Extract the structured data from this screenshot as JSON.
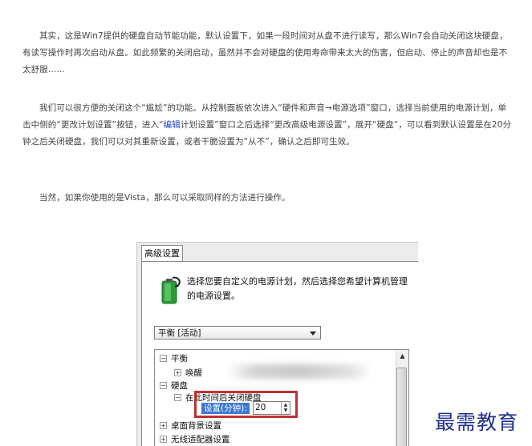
{
  "article": {
    "p1": "其实，这是Win7提供的硬盘自动节能功能，默认设置下，如果一段时间对从盘不进行读写，那么Win7会自动关闭这块硬盘，有读写操作时再次启动从盘。如此频繁的关闭启动，虽然并不会对硬盘的使用寿命带来太大的伤害，但启动、停止的声音却也是不太舒服……",
    "p2_a": "我们可以很方便的关闭这个“尴尬”的功能。从控制面板依次进入“硬件和声音→电源选项”窗口，选择当前使用的电源计划，单击中侧的“更改计划设置”按钮，进入“",
    "p2_link": "编辑",
    "p2_b": "计划设置”窗口之后选择“更改高级电源设置”，展开“硬盘”，可以看到默认设置是在20分钟之后关闭硬盘，我们可以对其重新设置，或者干脆设置为“从不”，确认之后即可生效。",
    "p3": "当然，如果你使用的是Vista，那么可以采取同样的方法进行操作。"
  },
  "dialog": {
    "tab_label": "高级设置",
    "description": "选择您要自定义的电源计划，然后选择您希望计算机管理的电源设置。",
    "plan_selected": "平衡 [活动]",
    "tree": {
      "balance": "平衡",
      "wake_password": "唤醒",
      "hard_disk": "硬盘",
      "turn_off_after": "在此时间后关闭硬盘",
      "setting_label": "设置(分钟):",
      "setting_value": "20",
      "desktop_background": "桌面背景设置",
      "wireless_adapter": "无线适配器设置"
    }
  },
  "watermark": "最需教育",
  "colors": {
    "link": "#1a3fd0",
    "highlight_border": "#c23131",
    "selection": "#3a79d2",
    "watermark": "#1f2f8f"
  }
}
